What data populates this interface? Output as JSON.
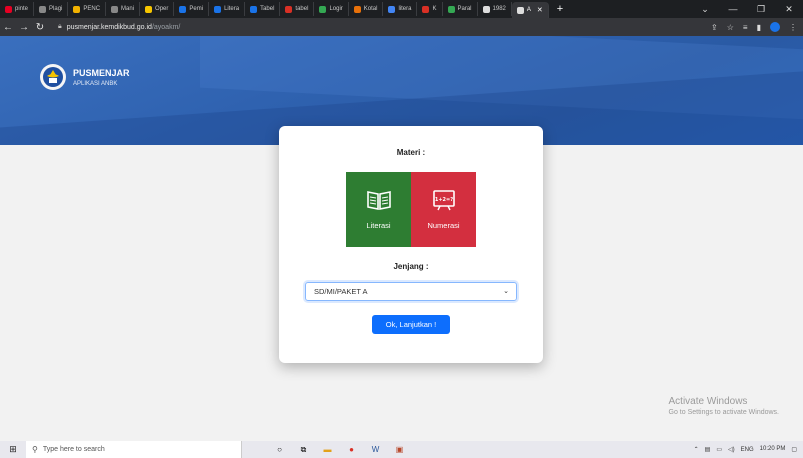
{
  "browser": {
    "tabs": [
      {
        "label": "pinte",
        "color": "#e60023"
      },
      {
        "label": "Plagi",
        "color": "#888888"
      },
      {
        "label": "PENC",
        "color": "#f2b200"
      },
      {
        "label": "Mani",
        "color": "#888888"
      },
      {
        "label": "Oper",
        "color": "#f7c600"
      },
      {
        "label": "Pemi",
        "color": "#1a73e8"
      },
      {
        "label": "Litera",
        "color": "#1a73e8"
      },
      {
        "label": "Tabel",
        "color": "#1a73e8"
      },
      {
        "label": "tabel",
        "color": "#d93025"
      },
      {
        "label": "Logir",
        "color": "#34a853"
      },
      {
        "label": "Kotal",
        "color": "#e8710a"
      },
      {
        "label": "litera",
        "color": "#4285f4"
      },
      {
        "label": "K",
        "color": "#d93025"
      },
      {
        "label": "Paral",
        "color": "#34a853"
      },
      {
        "label": "1982",
        "color": "#dddddd"
      }
    ],
    "active_tab": {
      "label": "A",
      "color": "#dddddd"
    },
    "new_tab": "+",
    "url_host": "pusmenjar.kemdikbud.go.id",
    "url_path": "/ayoakm/"
  },
  "header": {
    "brand_title": "PUSMENJAR",
    "brand_subtitle": "APLIKASI ANBK"
  },
  "card": {
    "materi_label": "Materi :",
    "tiles": [
      {
        "label": "Literasi",
        "color": "#2e7d32"
      },
      {
        "label": "Numerasi",
        "color": "#d32f3f"
      }
    ],
    "numerasi_icon_text": "1+2=?",
    "jenjang_label": "Jenjang :",
    "jenjang_selected": "SD/MI/PAKET A",
    "submit_label": "Ok, Lanjutkan !"
  },
  "watermark": {
    "line1": "Activate Windows",
    "line2": "Go to Settings to activate Windows."
  },
  "taskbar": {
    "search_placeholder": "Type here to search",
    "lang": "ENG",
    "time": "10:20 PM"
  }
}
